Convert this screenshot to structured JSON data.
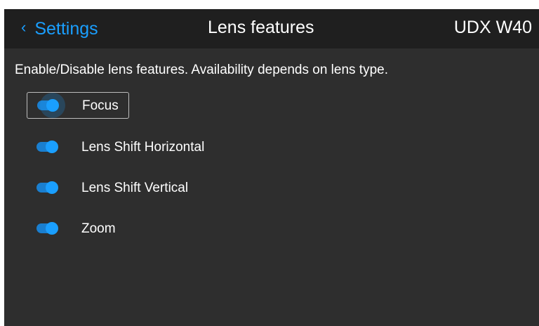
{
  "header": {
    "back_label": "Settings",
    "title": "Lens features",
    "device": "UDX W40"
  },
  "description": "Enable/Disable lens features. Availability depends on lens type.",
  "features": [
    {
      "label": "Focus",
      "enabled": true,
      "focused": true
    },
    {
      "label": "Lens Shift Horizontal",
      "enabled": true,
      "focused": false
    },
    {
      "label": "Lens Shift Vertical",
      "enabled": true,
      "focused": false
    },
    {
      "label": "Zoom",
      "enabled": true,
      "focused": false
    }
  ],
  "colors": {
    "accent": "#1a9fff",
    "background": "#2e2e2e",
    "header_background": "#1f1f1f",
    "text": "#ffffff"
  },
  "icons": {
    "back": "chevron-left-icon"
  }
}
